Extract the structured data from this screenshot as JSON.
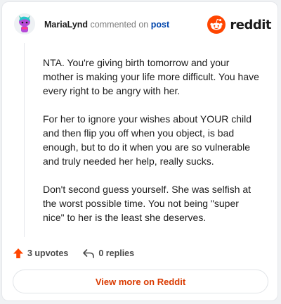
{
  "header": {
    "username": "MariaLynd",
    "commented_on": "commented on",
    "post_link": "post",
    "logo_text": "reddit"
  },
  "comment": {
    "paragraphs": [
      "NTA. You're giving birth tomorrow and your mother is making your life more difficult. You have every right to be angry with her.",
      "For her to ignore your wishes about YOUR child and then flip you off when you object, is bad enough, but to do it when you are so vulnerable and truly needed her help, really sucks.",
      "Don't second guess yourself. She was selfish at the worst possible time. You not being \"super nice\" to her is the least she deserves."
    ]
  },
  "actions": {
    "upvotes": "3 upvotes",
    "replies": "0 replies"
  },
  "footer": {
    "view_more": "View more on Reddit"
  },
  "colors": {
    "brand": "#ff4500",
    "link": "#0045ac",
    "view_more_text": "#d93a00"
  },
  "icons": {
    "avatar": "snoo-avatar-icon",
    "logo": "reddit-logo-icon",
    "upvote": "upvote-arrow-icon",
    "reply": "reply-arrow-icon"
  }
}
